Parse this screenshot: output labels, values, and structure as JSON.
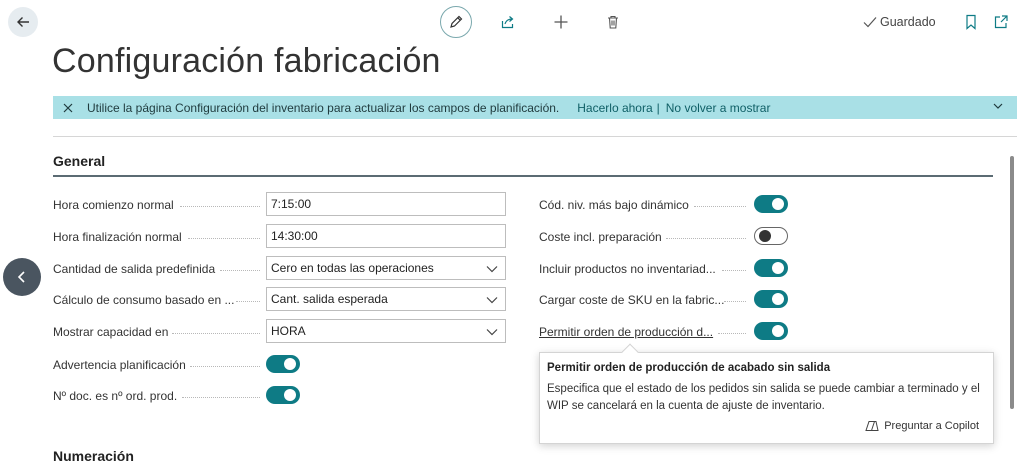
{
  "toolbar": {
    "saved_label": "Guardado"
  },
  "page": {
    "title": "Configuración fabricación"
  },
  "banner": {
    "message": "Utilice la página Configuración del inventario para actualizar los campos de planificación.",
    "action_now": "Hacerlo ahora",
    "separator": "|",
    "action_dismiss": "No volver a mostrar"
  },
  "general": {
    "title": "General",
    "left_fields": [
      {
        "label": "Hora comienzo normal",
        "value": "7:15:00"
      },
      {
        "label": "Hora finalización normal",
        "value": "14:30:00"
      },
      {
        "label": "Cantidad de salida predefinida",
        "value": "Cero en todas las operaciones"
      },
      {
        "label": "Cálculo de consumo basado en ...",
        "value": "Cant. salida esperada"
      },
      {
        "label": "Mostrar capacidad en",
        "value": "HORA"
      },
      {
        "label": "Advertencia planificación",
        "toggle": true
      },
      {
        "label": "Nº doc. es nº ord. prod.",
        "toggle": true
      }
    ],
    "right_fields": [
      {
        "label": "Cód. niv. más bajo dinámico",
        "toggle": true
      },
      {
        "label": "Coste incl. preparación",
        "toggle": false
      },
      {
        "label": "Incluir productos no inventariad...",
        "toggle": true
      },
      {
        "label": "Cargar coste de SKU en la fabric...",
        "toggle": true
      },
      {
        "label": "Permitir orden de producción d...",
        "toggle": true
      }
    ]
  },
  "tooltip": {
    "title": "Permitir orden de producción de acabado sin salida",
    "body": "Especifica que el estado de los pedidos sin salida se puede cambiar a terminado y el WIP se cancelará en la cuenta de ajuste de inventario.",
    "copilot_label": "Preguntar a Copilot"
  },
  "next_section": {
    "title": "Numeración"
  },
  "colors": {
    "accent": "#0e7b85",
    "banner": "#a9e0e6"
  }
}
